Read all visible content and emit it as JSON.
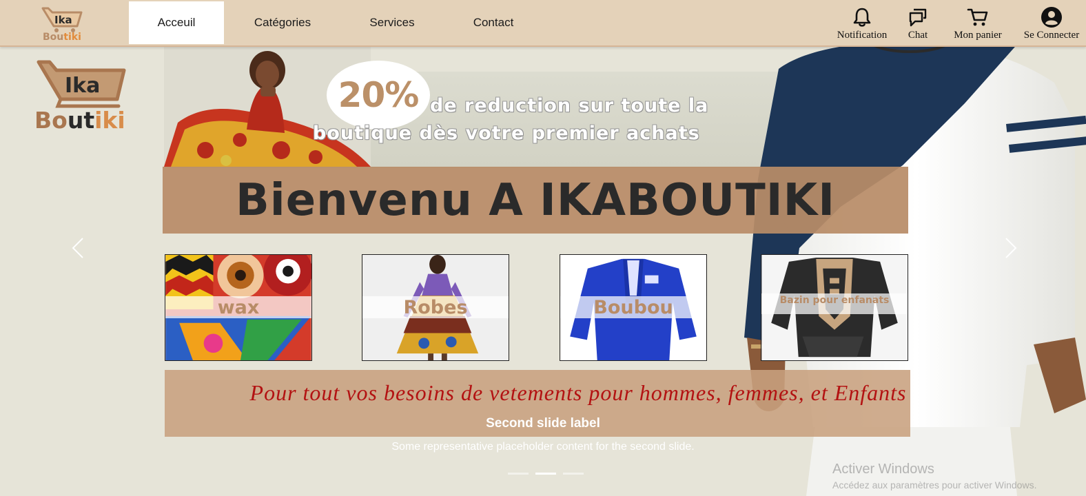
{
  "navbar": {
    "logo": {
      "line1": "Ika",
      "line2_a": "Bou",
      "line2_b": "tiki"
    },
    "links": [
      {
        "label": "Acceuil",
        "active": true
      },
      {
        "label": "Catégories",
        "active": false
      },
      {
        "label": "Services",
        "active": false
      },
      {
        "label": "Contact",
        "active": false
      }
    ],
    "icons": [
      {
        "icon": "bell-icon",
        "label": "Notification"
      },
      {
        "icon": "chat-icon",
        "label": "Chat"
      },
      {
        "icon": "cart-icon",
        "label": "Mon  panier"
      },
      {
        "icon": "user-icon",
        "label": "Se  Connecter"
      }
    ]
  },
  "hero": {
    "logo": {
      "line1": "Ika",
      "line2_a": "Bo",
      "line2_b": "ut",
      "line2_c": "iki"
    },
    "promo": {
      "percent": "20%",
      "line1": "de reduction sur toute la",
      "line2": "boutique dès votre premier achats"
    },
    "welcome": "Bienvenu A IKABOUTIKI",
    "categories": [
      {
        "label": "wax"
      },
      {
        "label": "Robes"
      },
      {
        "label": "Boubou"
      },
      {
        "label": "Bazin pour enfanats"
      }
    ],
    "tagline": "Pour tout vos besoins de vetements pour hommes, femmes, et Enfants",
    "carousel": {
      "caption_title": "Second slide label",
      "caption_text": "Some representative placeholder content for the second slide.",
      "slide_count": 3,
      "active_index": 1
    }
  },
  "watermark": {
    "title": "Activer Windows",
    "text": "Accédez aux paramètres pour activer Windows."
  },
  "colors": {
    "navbar_bg": "#e4d2b9",
    "accent_tan": "#b88c67",
    "page_bg": "#e6e4d8",
    "tagline_red": "#b31212"
  }
}
